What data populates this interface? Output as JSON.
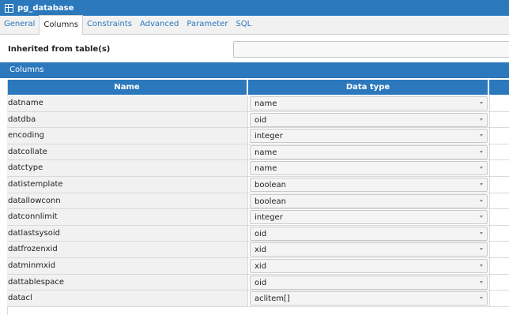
{
  "window": {
    "title": "pg_database"
  },
  "tabs": [
    {
      "label": "General",
      "active": false
    },
    {
      "label": "Columns",
      "active": true
    },
    {
      "label": "Constraints",
      "active": false
    },
    {
      "label": "Advanced",
      "active": false
    },
    {
      "label": "Parameter",
      "active": false
    },
    {
      "label": "SQL",
      "active": false
    }
  ],
  "inherited": {
    "label": "Inherited from table(s)",
    "value": ""
  },
  "columns_section": {
    "title": "Columns",
    "headers": {
      "name": "Name",
      "data_type": "Data type"
    },
    "rows": [
      {
        "name": "datname",
        "type": "name"
      },
      {
        "name": "datdba",
        "type": "oid"
      },
      {
        "name": "encoding",
        "type": "integer"
      },
      {
        "name": "datcollate",
        "type": "name"
      },
      {
        "name": "datctype",
        "type": "name"
      },
      {
        "name": "datistemplate",
        "type": "boolean"
      },
      {
        "name": "datallowconn",
        "type": "boolean"
      },
      {
        "name": "datconnlimit",
        "type": "integer"
      },
      {
        "name": "datlastsysoid",
        "type": "oid"
      },
      {
        "name": "datfrozenxid",
        "type": "xid"
      },
      {
        "name": "datminmxid",
        "type": "xid"
      },
      {
        "name": "dattablespace",
        "type": "oid"
      },
      {
        "name": "datacl",
        "type": "aclitem[]"
      }
    ]
  },
  "colors": {
    "accent": "#2c78bd",
    "row_bg": "#f1f1f1"
  }
}
